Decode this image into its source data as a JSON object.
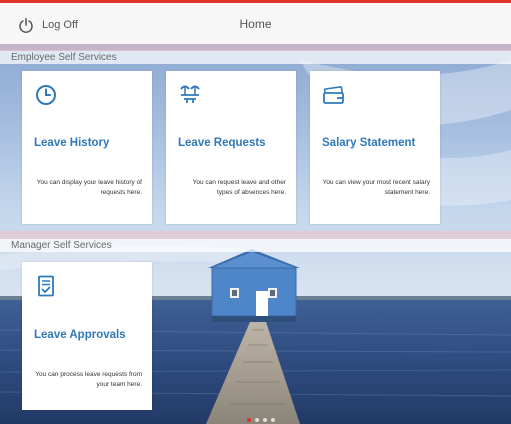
{
  "topbar": {
    "logoff_label": "Log Off",
    "page_title": "Home",
    "accent_color": "#e0322b"
  },
  "sections": {
    "employee": {
      "title": "Employee Self Services",
      "tiles": [
        {
          "icon": "clock-icon",
          "title": "Leave History",
          "description": "You can display your leave history of requests here."
        },
        {
          "icon": "beach-icon",
          "title": "Leave Requests",
          "description": "You can request leave and other types of absences here."
        },
        {
          "icon": "wallet-icon",
          "title": "Salary Statement",
          "description": "You can view your most recent salary statement here."
        }
      ]
    },
    "manager": {
      "title": "Manager Self Services",
      "tiles": [
        {
          "icon": "approval-document-icon",
          "title": "Leave Approvals",
          "description": "You can process leave requests from your team here."
        }
      ]
    }
  },
  "carousel": {
    "page_count": 4,
    "active_index": 0
  }
}
